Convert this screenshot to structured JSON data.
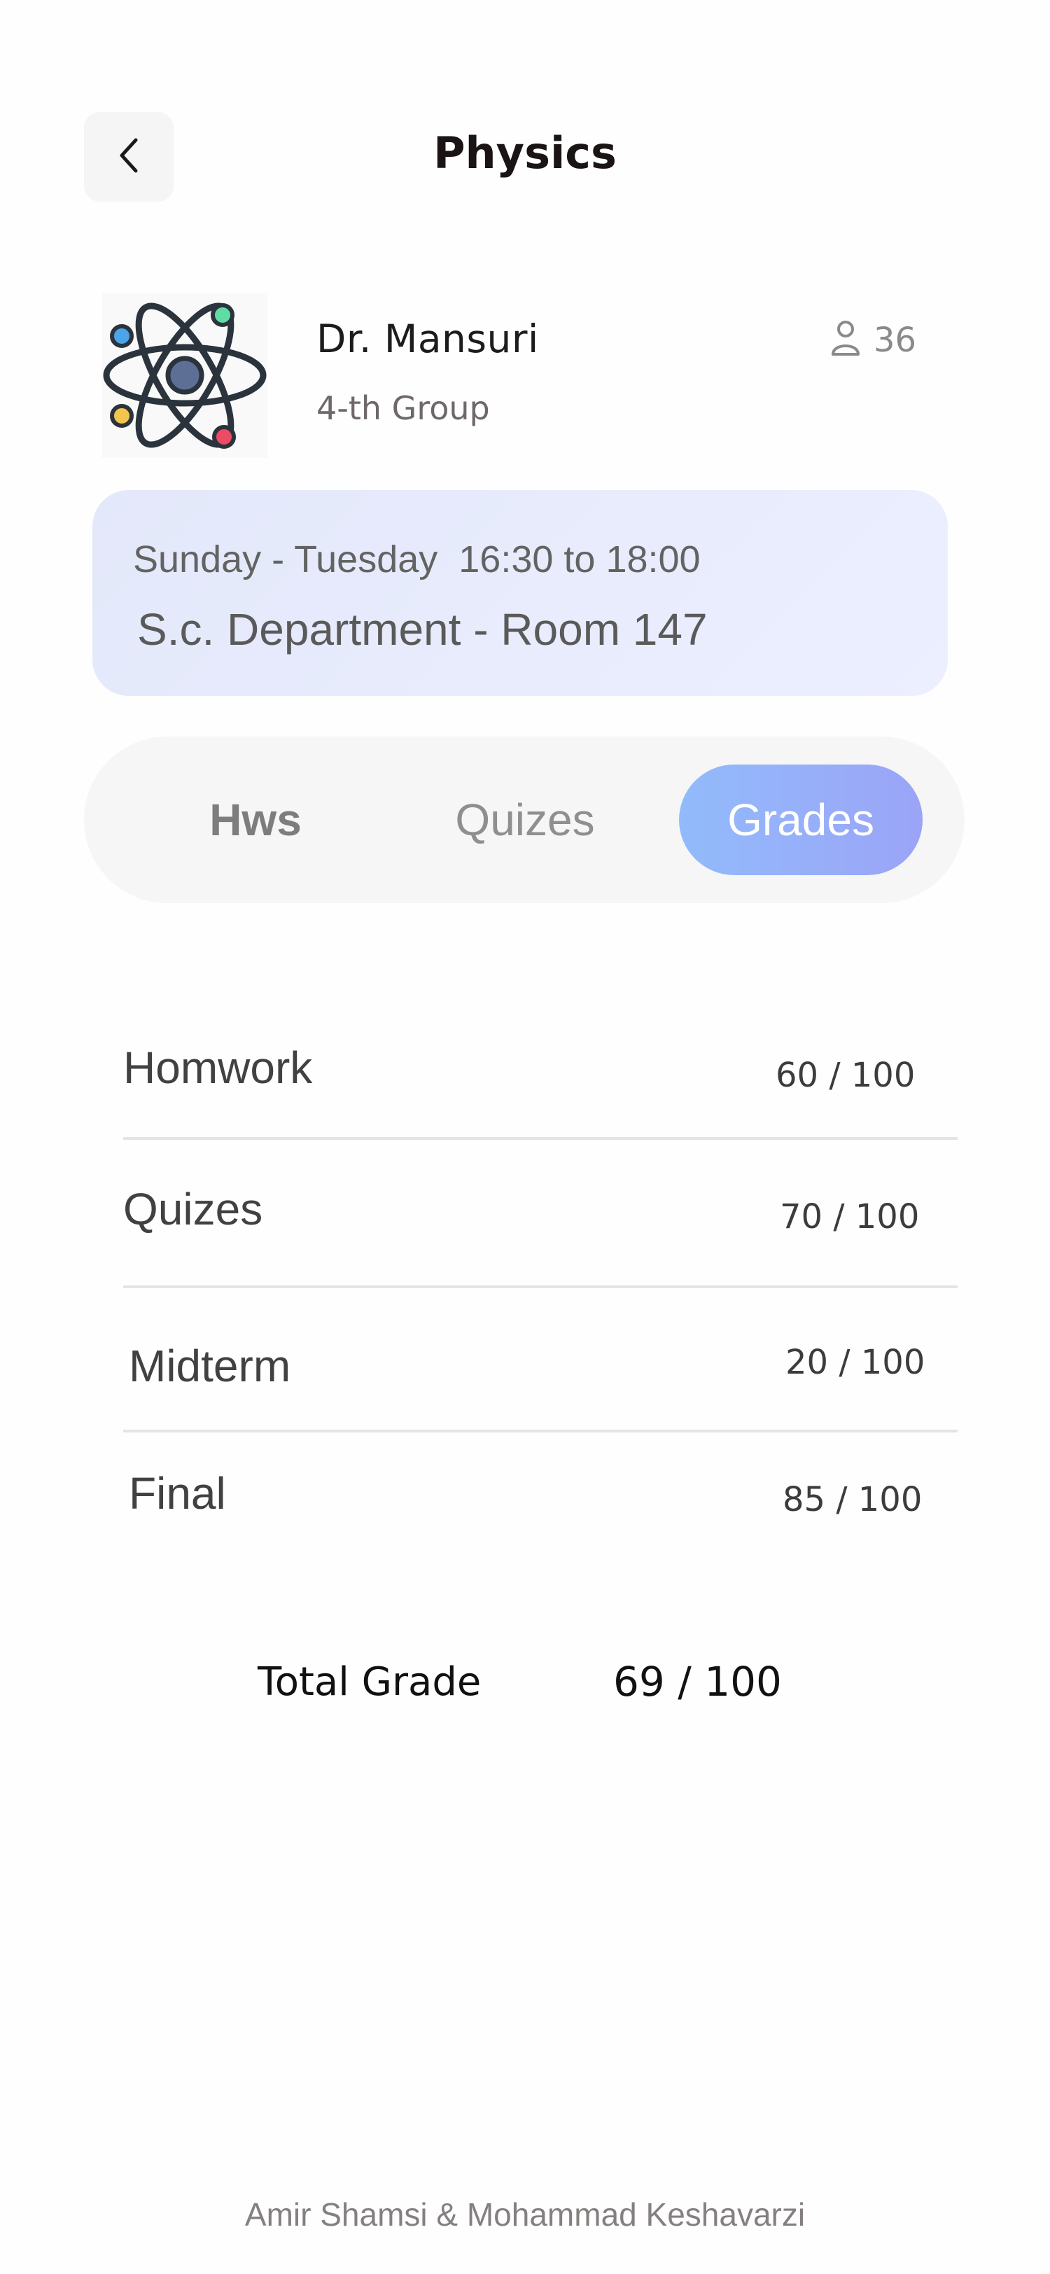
{
  "header": {
    "title": "Physics",
    "back_icon": "chevron-left-icon"
  },
  "course": {
    "logo_icon": "atom-icon",
    "teacher_name": "Dr. Mansuri",
    "group": "4-th Group",
    "student_count": "36",
    "student_icon": "person-icon"
  },
  "schedule": {
    "days_time": "Sunday - Tuesday  16:30 to 18:00",
    "location": "S.c. Department - Room 147"
  },
  "tabs": [
    {
      "label": "Hws"
    },
    {
      "label": "Quizes"
    },
    {
      "label": "Grades",
      "active": true
    }
  ],
  "grades": [
    {
      "label": "Homwork",
      "value": "60 / 100"
    },
    {
      "label": "Quizes",
      "value": "70 / 100"
    },
    {
      "label": "Midterm",
      "value": "20 / 100"
    },
    {
      "label": "Final",
      "value": "85 / 100"
    }
  ],
  "total": {
    "label": "Total Grade",
    "value": "69 / 100"
  },
  "footer": {
    "credit": "Amir Shamsi & Mohammad Keshavarzi"
  },
  "colors": {
    "accent_gradient_start": "#92bbfb",
    "accent_gradient_end": "#9ba4f7",
    "schedule_card_bg": "#e6eafb",
    "tab_bar_bg": "#f5f6f5"
  }
}
